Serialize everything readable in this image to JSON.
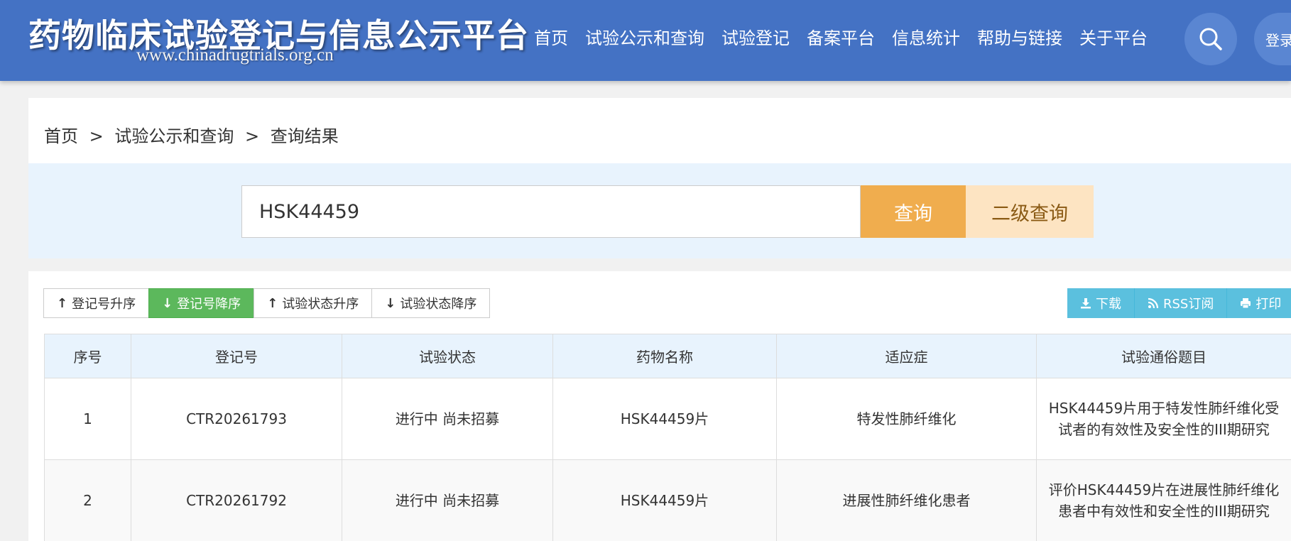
{
  "header": {
    "site_title": "药物临床试验登记与信息公示平台",
    "site_url": "www.chinadrugtrials.org.cn",
    "nav": [
      "首页",
      "试验公示和查询",
      "试验登记",
      "备案平台",
      "信息统计",
      "帮助与链接",
      "关于平台"
    ],
    "search_icon": "search-icon",
    "login_label": "登录"
  },
  "breadcrumb": {
    "items": [
      "首页",
      "试验公示和查询",
      "查询结果"
    ],
    "separator": ">"
  },
  "search": {
    "value": "HSK44459",
    "query_label": "查询",
    "advanced_label": "二级查询"
  },
  "sort": {
    "buttons": [
      {
        "label": "登记号升序",
        "arrow": "↑"
      },
      {
        "label": "登记号降序",
        "arrow": "↓"
      },
      {
        "label": "试验状态升序",
        "arrow": "↑"
      },
      {
        "label": "试验状态降序",
        "arrow": "↓"
      }
    ]
  },
  "actions": {
    "download": "下载",
    "rss": "RSS订阅",
    "print": "打印"
  },
  "table": {
    "headers": [
      "序号",
      "登记号",
      "试验状态",
      "药物名称",
      "适应症",
      "试验通俗题目"
    ],
    "rows": [
      {
        "no": "1",
        "reg": "CTR20261793",
        "status": "进行中 尚未招募",
        "drug": "HSK44459片",
        "indication": "特发性肺纤维化",
        "title": "HSK44459片用于特发性肺纤维化受试者的有效性及安全性的III期研究"
      },
      {
        "no": "2",
        "reg": "CTR20261792",
        "status": "进行中 尚未招募",
        "drug": "HSK44459片",
        "indication": "进展性肺纤维化患者",
        "title": "评价HSK44459片在进展性肺纤维化患者中有效性和安全性的III期研究"
      }
    ]
  },
  "colors": {
    "header_bg": "#4472c4",
    "query_button": "#f0ad4e",
    "advanced_button": "#fde4c2",
    "active_sort": "#5cb85c",
    "action_button": "#5bc0de",
    "search_panel_bg": "#e8f3fd"
  }
}
